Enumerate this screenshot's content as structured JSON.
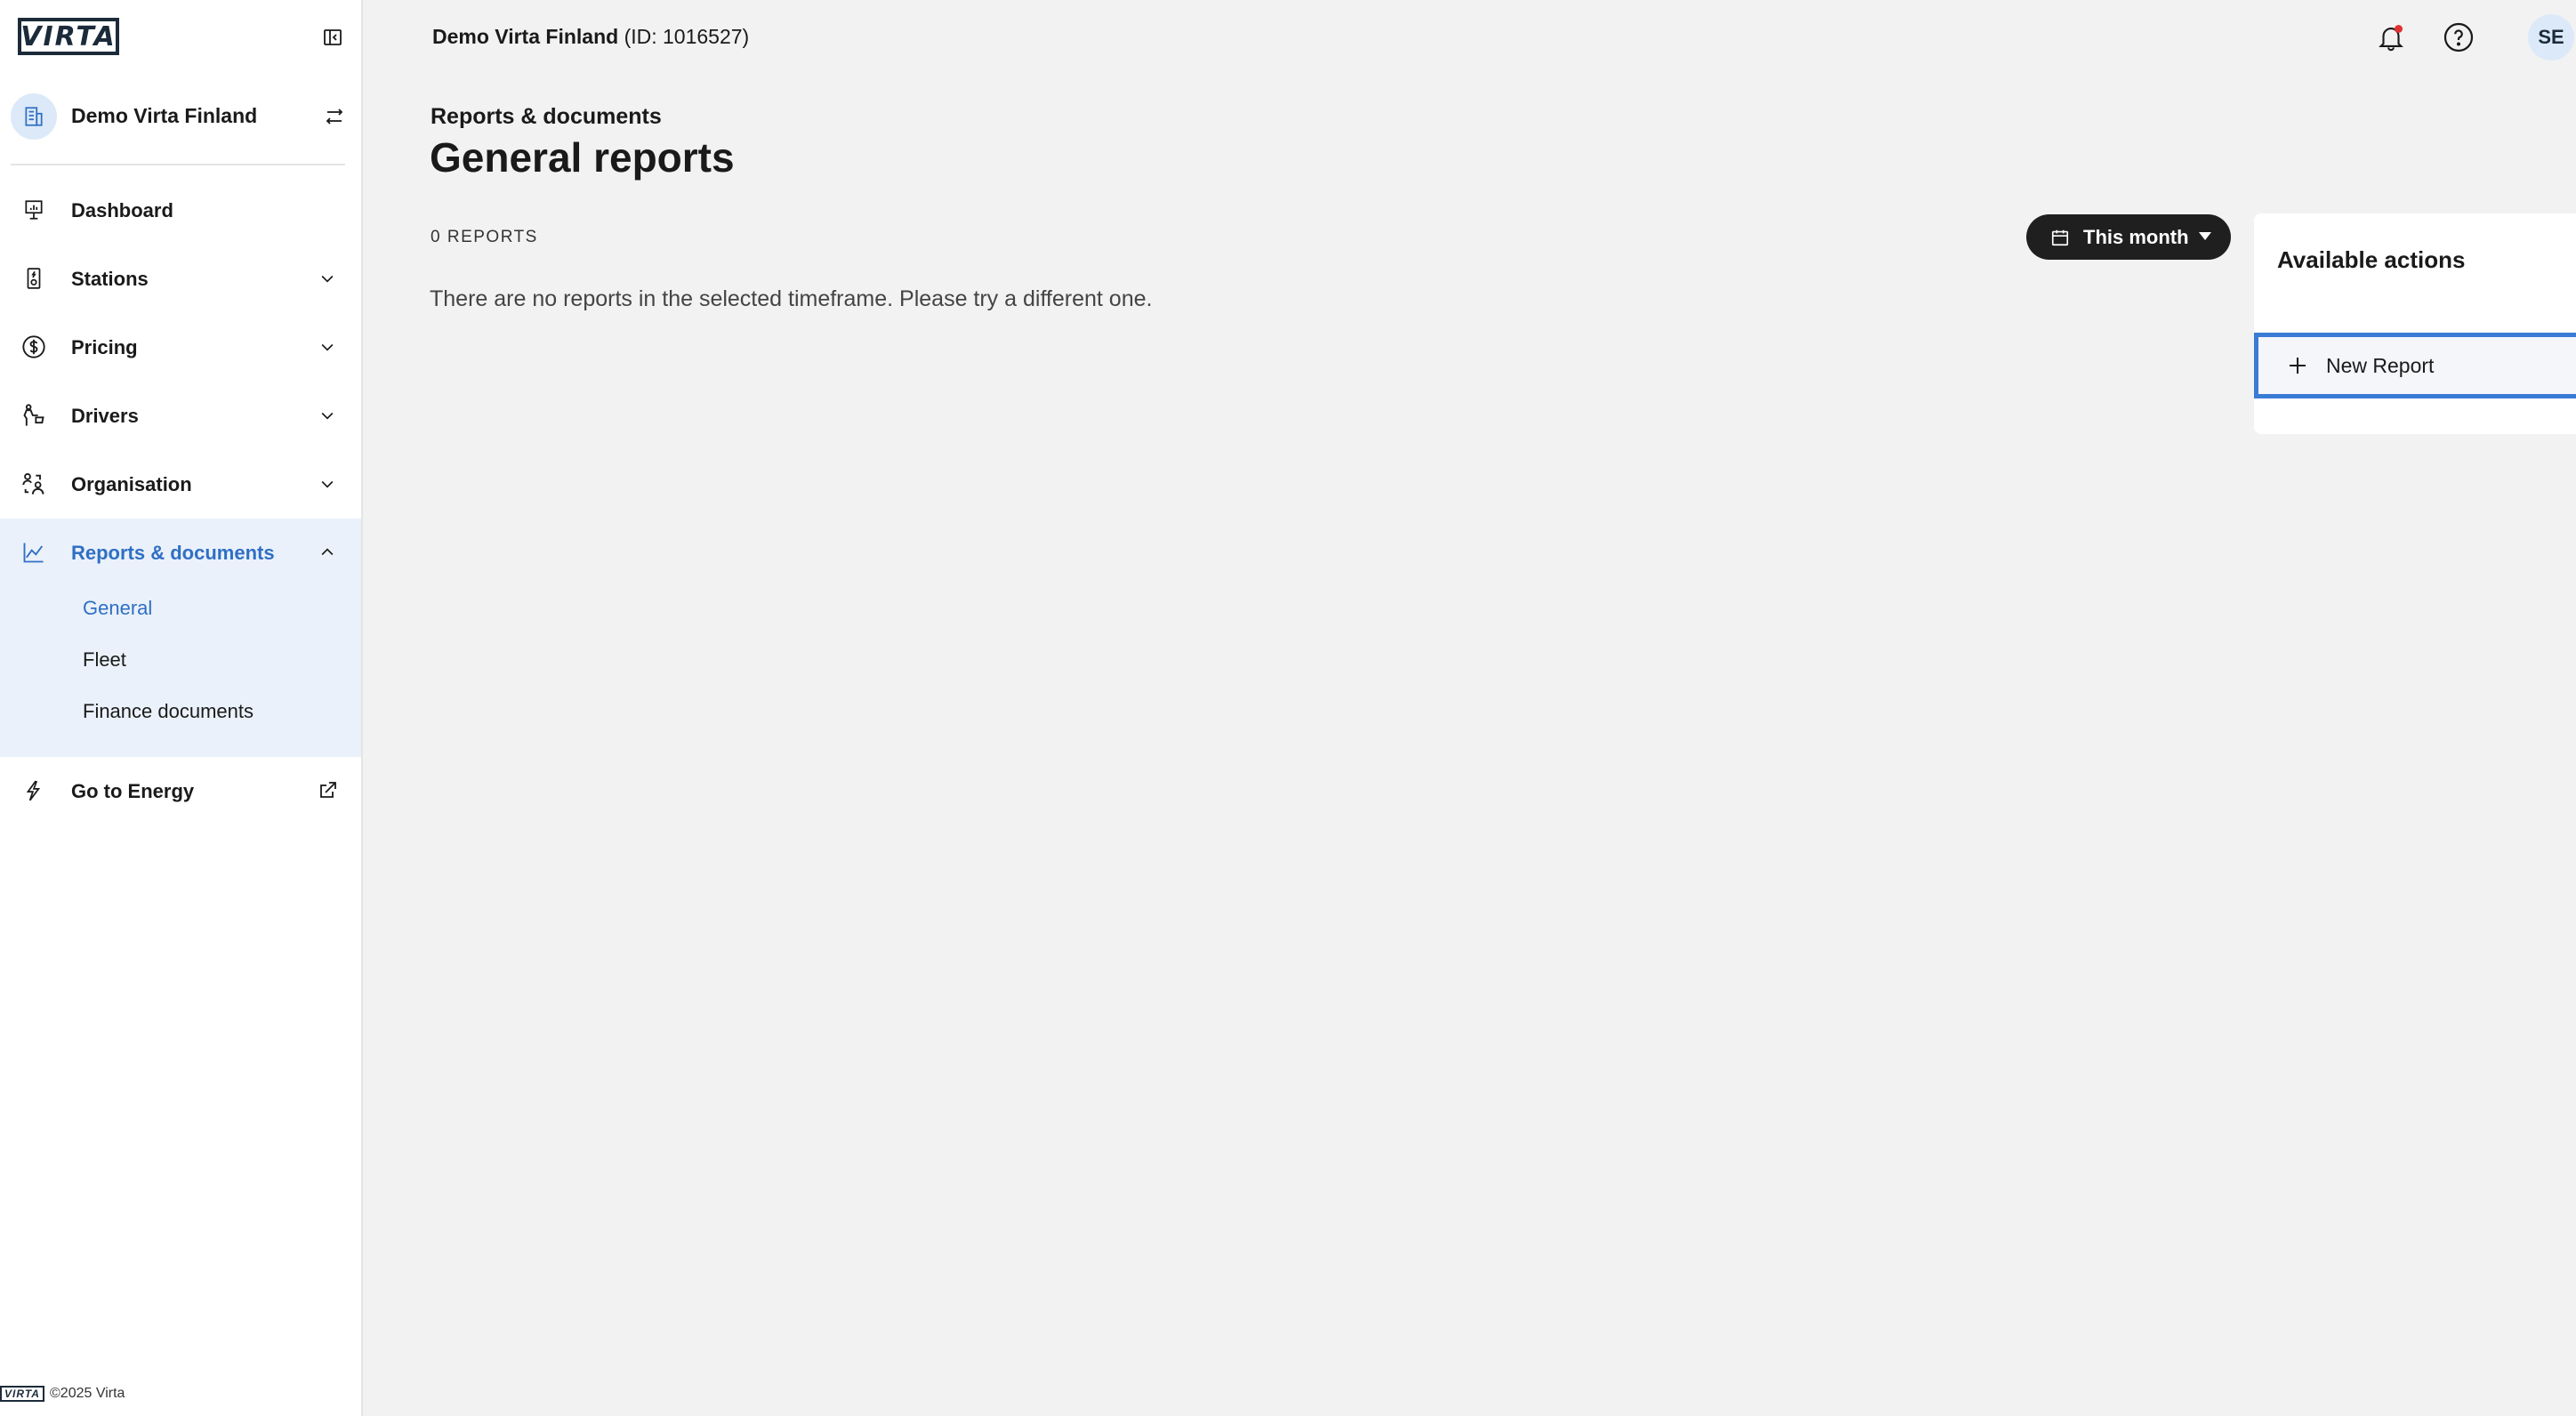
{
  "brand": {
    "logo_text": "VIRTA",
    "accent_color": "#2f6fc4"
  },
  "sidebar": {
    "org_name": "Demo Virta Finland",
    "items": [
      {
        "label": "Dashboard",
        "icon": "dashboard-icon"
      },
      {
        "label": "Stations",
        "icon": "station-icon"
      },
      {
        "label": "Pricing",
        "icon": "dollar-icon"
      },
      {
        "label": "Drivers",
        "icon": "driver-icon"
      },
      {
        "label": "Organisation",
        "icon": "organisation-icon"
      },
      {
        "label": "Reports & documents",
        "icon": "chart-icon"
      }
    ],
    "sub_items": [
      {
        "label": "General",
        "active": true
      },
      {
        "label": "Fleet",
        "active": false
      },
      {
        "label": "Finance documents",
        "active": false
      }
    ],
    "energy_link": {
      "label": "Go to Energy",
      "icon": "lightning-icon"
    },
    "footer": "©2025 Virta"
  },
  "topbar": {
    "org_name": "Demo Virta Finland",
    "org_id": "(ID: 1016527)",
    "user_initials": "SE"
  },
  "main": {
    "breadcrumb": "Reports & documents",
    "title": "General reports",
    "report_count": "0 REPORTS",
    "empty_message": "There are no reports in the selected timeframe. Please try a different one.",
    "period_selector": "This month"
  },
  "actions": {
    "title": "Available actions",
    "new_report": "New Report"
  }
}
